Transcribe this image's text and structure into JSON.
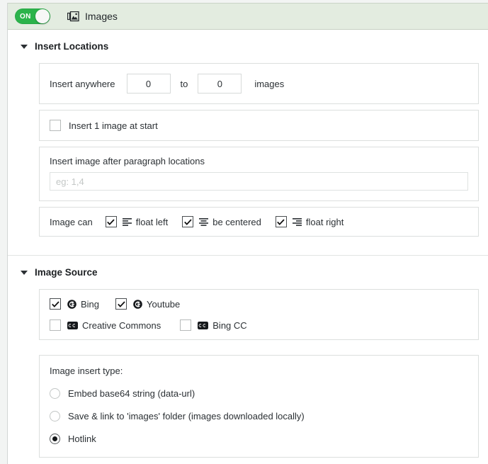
{
  "header": {
    "toggle_state": "ON",
    "toggle_on": true,
    "icon": "images-icon",
    "title": "Images",
    "background_color": "#e3ece0",
    "toggle_color": "#2bb34b"
  },
  "sections": [
    {
      "id": "insert-locations",
      "title": "Insert Locations",
      "expanded": true
    },
    {
      "id": "image-source",
      "title": "Image Source",
      "expanded": true
    }
  ],
  "insert_locations": {
    "anywhere": {
      "label": "Insert anywhere",
      "min_value": "0",
      "between_label": "to",
      "max_value": "0",
      "suffix_label": "images"
    },
    "insert_at_start": {
      "label": "Insert 1 image at start",
      "checked": false
    },
    "paragraph_locations": {
      "label": "Insert image after paragraph locations",
      "value": "",
      "placeholder": "eg: 1,4"
    },
    "float_options": {
      "label": "Image can",
      "options": [
        {
          "label": "float left",
          "icon": "align-left-icon",
          "checked": true
        },
        {
          "label": "be centered",
          "icon": "align-center-icon",
          "checked": true
        },
        {
          "label": "float right",
          "icon": "align-right-icon",
          "checked": true
        }
      ]
    }
  },
  "image_source": {
    "providers": [
      {
        "label": "Bing",
        "icon": "bing-circle-icon",
        "checked": true
      },
      {
        "label": "Youtube",
        "icon": "youtube-circle-icon",
        "checked": true
      },
      {
        "label": "Creative Commons",
        "icon": "cc-badge-icon",
        "checked": false
      },
      {
        "label": "Bing CC",
        "icon": "cc-badge-icon",
        "checked": false
      }
    ],
    "insert_type": {
      "title": "Image insert type:",
      "options": [
        {
          "label": "Embed base64 string (data-url)",
          "selected": false
        },
        {
          "label": "Save & link to 'images' folder (images downloaded locally)",
          "selected": false
        },
        {
          "label": "Hotlink",
          "selected": true
        }
      ]
    }
  }
}
